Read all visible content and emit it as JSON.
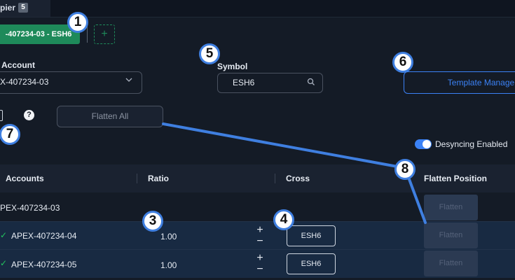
{
  "tab": {
    "label": "pier",
    "badge": "5"
  },
  "link_chip": {
    "label": "-407234-03 - ESH6",
    "add": "+"
  },
  "account": {
    "label": "Account",
    "value": "X-407234-03",
    "chevron": "chevron-down-icon"
  },
  "symbol": {
    "label": "Symbol",
    "value": "ESH6",
    "icon": "search-icon"
  },
  "template_manager": "Template Manager",
  "help": "?",
  "flatten_all": "Flatten All",
  "desync": {
    "label": "Desyncing Enabled",
    "enabled": true
  },
  "table": {
    "headers": [
      "Accounts",
      "Ratio",
      "Cross",
      "Flatten Position"
    ],
    "rows": [
      {
        "account": "PEX-407234-03",
        "ratio": "",
        "cross": "",
        "flatten": "Flatten"
      },
      {
        "account": "APEX-407234-04",
        "ratio": "1.00",
        "cross": "ESH6",
        "flatten": "Flatten",
        "plus": "+",
        "minus": "−"
      },
      {
        "account": "APEX-407234-05",
        "ratio": "1.00",
        "cross": "ESH6",
        "flatten": "Flatten",
        "plus": "+",
        "minus": "−"
      }
    ]
  },
  "callouts": [
    "1",
    "3",
    "4",
    "5",
    "6",
    "7",
    "8"
  ],
  "colors": {
    "accent": "#3b82f6",
    "link_green": "#1e8a5a",
    "callout_blue": "#3f7fe0"
  }
}
